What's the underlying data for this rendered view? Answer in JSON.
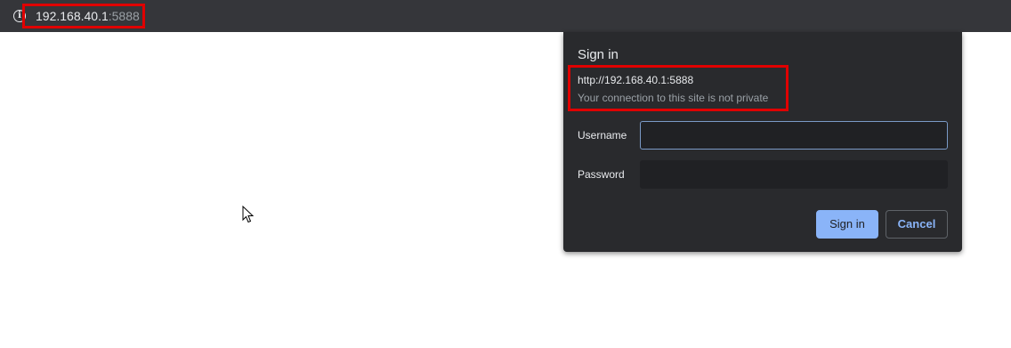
{
  "address_bar": {
    "url_host": "192.168.40.1",
    "url_port": ":5888",
    "info_icon": "info-icon"
  },
  "dialog": {
    "title": "Sign in",
    "origin": "http://192.168.40.1:5888",
    "warning": "Your connection to this site is not private",
    "username_label": "Username",
    "password_label": "Password",
    "username_value": "",
    "password_value": "",
    "signin_label": "Sign in",
    "cancel_label": "Cancel"
  },
  "colors": {
    "highlight": "#e00000",
    "accent": "#8ab4f8",
    "dialog_bg": "#292a2d"
  }
}
